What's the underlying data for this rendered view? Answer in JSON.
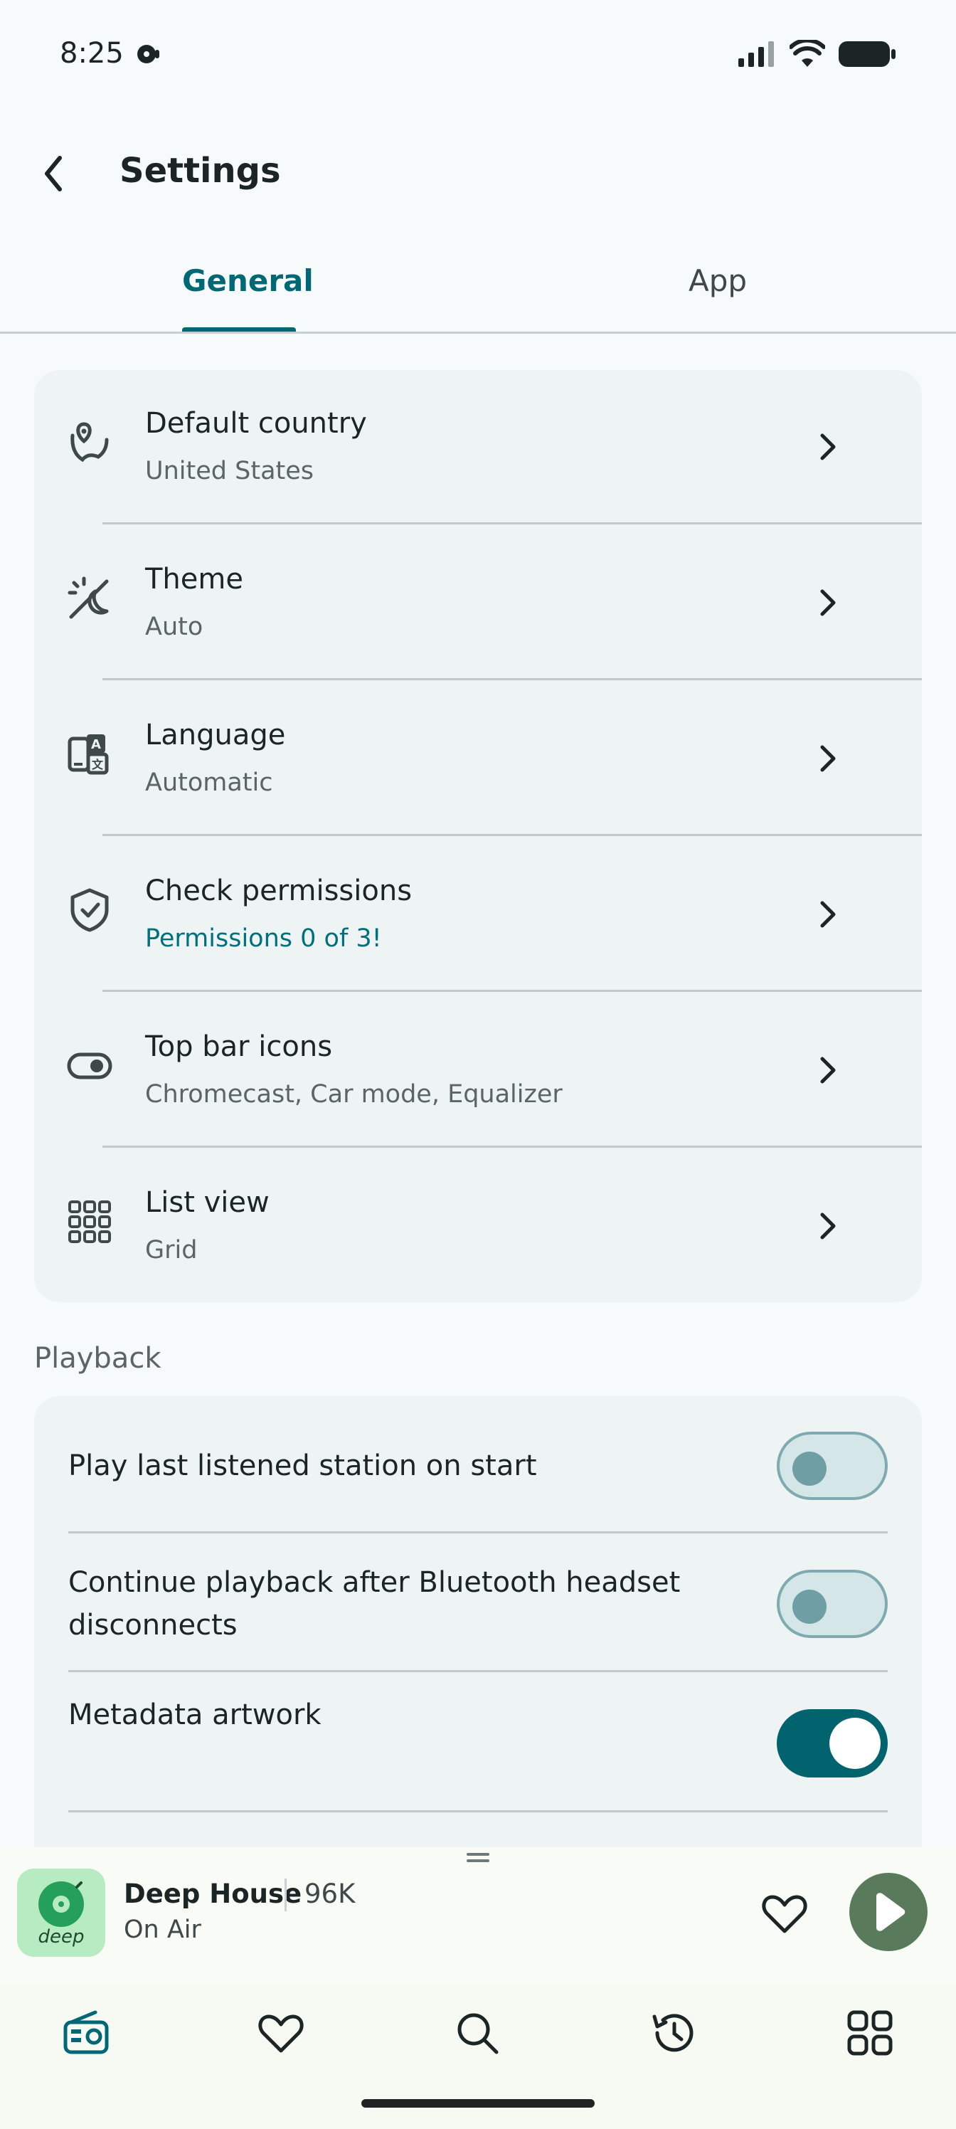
{
  "status_bar": {
    "time": "8:25"
  },
  "header": {
    "title": "Settings"
  },
  "tabs": [
    {
      "label": "General"
    },
    {
      "label": "App"
    }
  ],
  "general_items": [
    {
      "title": "Default country",
      "subtitle": "United States",
      "icon": "map-pin-icon"
    },
    {
      "title": "Theme",
      "subtitle": "Auto",
      "icon": "theme-icon"
    },
    {
      "title": "Language",
      "subtitle": "Automatic",
      "icon": "translate-icon"
    },
    {
      "title": "Check permissions",
      "subtitle": "Permissions 0 of 3!",
      "icon": "shield-check-icon"
    },
    {
      "title": "Top bar icons",
      "subtitle": "Chromecast, Car mode, Equalizer",
      "icon": "toggle-icon"
    },
    {
      "title": "List view",
      "subtitle": "Grid",
      "icon": "grid-icon"
    }
  ],
  "playback": {
    "section_label": "Playback",
    "items": [
      {
        "label": "Play last listened station on start",
        "enabled": false
      },
      {
        "label": "Continue playback after Bluetooth headset disconnects",
        "enabled": false
      },
      {
        "label": "Metadata artwork",
        "enabled": true
      }
    ]
  },
  "player": {
    "station": "Deep House",
    "bitrate": "96K",
    "status": "On Air",
    "logo_text": "deep"
  },
  "colors": {
    "accent": "#006874",
    "play_button": "#5a7a5c",
    "card": "#eef3f4"
  },
  "nav": [
    "radio-icon",
    "favorites-icon",
    "search-icon",
    "history-icon",
    "apps-icon"
  ]
}
